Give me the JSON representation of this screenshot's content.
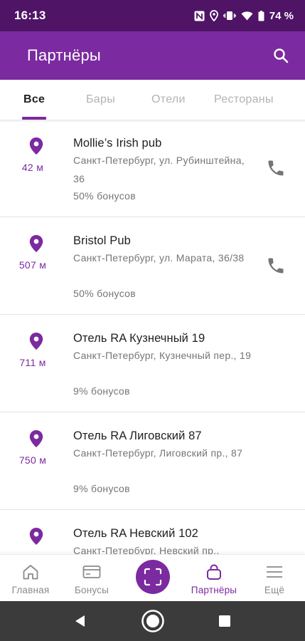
{
  "status_bar": {
    "time": "16:13",
    "battery": "74 %",
    "icons": [
      "nfc-icon",
      "location-icon",
      "vibrate-icon",
      "wifi-icon",
      "battery-icon"
    ]
  },
  "app_bar": {
    "title": "Партнёры",
    "search_icon": "search-icon"
  },
  "tabs": [
    {
      "label": "Все",
      "active": true
    },
    {
      "label": "Бары",
      "active": false
    },
    {
      "label": "Отели",
      "active": false
    },
    {
      "label": "Рестораны",
      "active": false
    }
  ],
  "partners": [
    {
      "distance": "42 м",
      "name": "Mollie’s Irish pub",
      "address": "Санкт-Петербург, ул. Рубинштейна, 36",
      "bonus": "50% бонусов",
      "has_phone": true
    },
    {
      "distance": "507 м",
      "name": "Bristol Pub",
      "address": "Санкт-Петербург, ул. Марата, 36/38",
      "bonus": "50% бонусов",
      "has_phone": true
    },
    {
      "distance": "711 м",
      "name": "Отель RA Кузнечный 19",
      "address": "Санкт-Петербург, Кузнечный пер., 19",
      "bonus": "9% бонусов",
      "has_phone": false
    },
    {
      "distance": "750 м",
      "name": "Отель RA Лиговский 87",
      "address": "Санкт-Петербург, Лиговский пр., 87",
      "bonus": "9% бонусов",
      "has_phone": false
    },
    {
      "distance": "",
      "name": "Отель RA Невский 102",
      "address": "Санкт-Петербург, Невский пр.,",
      "bonus": "",
      "has_phone": false
    }
  ],
  "bottom_nav": {
    "items": [
      {
        "label": "Главная",
        "icon": "home-icon",
        "active": false
      },
      {
        "label": "Бонусы",
        "icon": "card-icon",
        "active": false
      },
      {
        "label": "Партнёры",
        "icon": "bag-icon",
        "active": true
      },
      {
        "label": "Ещё",
        "icon": "menu-icon",
        "active": false
      }
    ],
    "scan_icon": "scan-icon"
  },
  "colors": {
    "primary": "#7b2aa0",
    "status_bar": "#4f1466",
    "secondary_text": "#757575",
    "inactive_tab": "#b3b3b3"
  }
}
